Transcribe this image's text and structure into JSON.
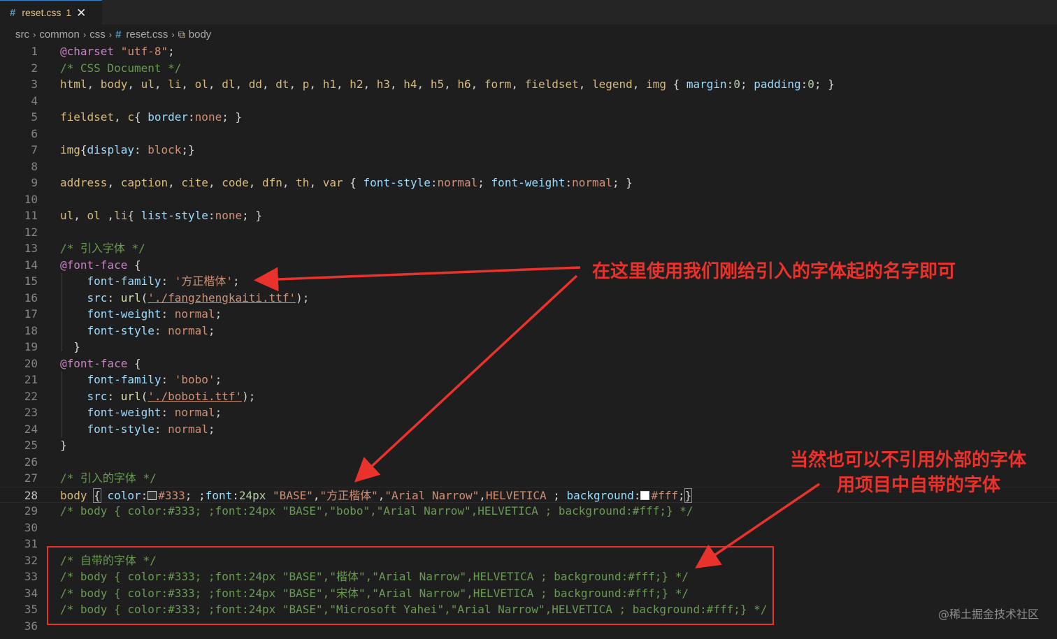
{
  "tab": {
    "icon": "css-hash-icon",
    "icon_glyph": "#",
    "filename": "reset.css",
    "problems": "1",
    "close_glyph": "✕"
  },
  "breadcrumb": {
    "items": [
      "src",
      "common",
      "css",
      "reset.css",
      "body"
    ],
    "separator": "›"
  },
  "editor": {
    "active_line": 28,
    "lines": [
      {
        "n": "1",
        "tokens": [
          [
            "at",
            "@charset"
          ],
          [
            "pun",
            " "
          ],
          [
            "str",
            "\"utf-8\""
          ],
          [
            "pun",
            ";"
          ]
        ]
      },
      {
        "n": "2",
        "tokens": [
          [
            "com",
            "/* CSS Document */"
          ]
        ]
      },
      {
        "n": "3",
        "tokens": [
          [
            "sel",
            "html"
          ],
          [
            "pun",
            ", "
          ],
          [
            "sel",
            "body"
          ],
          [
            "pun",
            ", "
          ],
          [
            "sel",
            "ul"
          ],
          [
            "pun",
            ", "
          ],
          [
            "sel",
            "li"
          ],
          [
            "pun",
            ", "
          ],
          [
            "sel",
            "ol"
          ],
          [
            "pun",
            ", "
          ],
          [
            "sel",
            "dl"
          ],
          [
            "pun",
            ", "
          ],
          [
            "sel",
            "dd"
          ],
          [
            "pun",
            ", "
          ],
          [
            "sel",
            "dt"
          ],
          [
            "pun",
            ", "
          ],
          [
            "sel",
            "p"
          ],
          [
            "pun",
            ", "
          ],
          [
            "sel",
            "h1"
          ],
          [
            "pun",
            ", "
          ],
          [
            "sel",
            "h2"
          ],
          [
            "pun",
            ", "
          ],
          [
            "sel",
            "h3"
          ],
          [
            "pun",
            ", "
          ],
          [
            "sel",
            "h4"
          ],
          [
            "pun",
            ", "
          ],
          [
            "sel",
            "h5"
          ],
          [
            "pun",
            ", "
          ],
          [
            "sel",
            "h6"
          ],
          [
            "pun",
            ", "
          ],
          [
            "sel",
            "form"
          ],
          [
            "pun",
            ", "
          ],
          [
            "sel",
            "fieldset"
          ],
          [
            "pun",
            ", "
          ],
          [
            "sel",
            "legend"
          ],
          [
            "pun",
            ", "
          ],
          [
            "sel",
            "img"
          ],
          [
            "pun",
            " { "
          ],
          [
            "prop",
            "margin"
          ],
          [
            "pun",
            ":"
          ],
          [
            "num",
            "0"
          ],
          [
            "pun",
            "; "
          ],
          [
            "prop",
            "padding"
          ],
          [
            "pun",
            ":"
          ],
          [
            "num",
            "0"
          ],
          [
            "pun",
            "; }"
          ]
        ]
      },
      {
        "n": "4",
        "tokens": []
      },
      {
        "n": "5",
        "tokens": [
          [
            "sel",
            "fieldset"
          ],
          [
            "pun",
            ", "
          ],
          [
            "sel",
            "c"
          ],
          [
            "pun",
            "{ "
          ],
          [
            "prop",
            "border"
          ],
          [
            "pun",
            ":"
          ],
          [
            "val",
            "none"
          ],
          [
            "pun",
            "; }"
          ]
        ]
      },
      {
        "n": "6",
        "tokens": []
      },
      {
        "n": "7",
        "tokens": [
          [
            "sel",
            "img"
          ],
          [
            "pun",
            "{"
          ],
          [
            "prop",
            "display"
          ],
          [
            "pun",
            ": "
          ],
          [
            "val",
            "block"
          ],
          [
            "pun",
            ";}"
          ]
        ]
      },
      {
        "n": "8",
        "tokens": []
      },
      {
        "n": "9",
        "tokens": [
          [
            "sel",
            "address"
          ],
          [
            "pun",
            ", "
          ],
          [
            "sel",
            "caption"
          ],
          [
            "pun",
            ", "
          ],
          [
            "sel",
            "cite"
          ],
          [
            "pun",
            ", "
          ],
          [
            "sel",
            "code"
          ],
          [
            "pun",
            ", "
          ],
          [
            "sel",
            "dfn"
          ],
          [
            "pun",
            ", "
          ],
          [
            "sel",
            "th"
          ],
          [
            "pun",
            ", "
          ],
          [
            "sel",
            "var"
          ],
          [
            "pun",
            " { "
          ],
          [
            "prop",
            "font-style"
          ],
          [
            "pun",
            ":"
          ],
          [
            "val",
            "normal"
          ],
          [
            "pun",
            "; "
          ],
          [
            "prop",
            "font-weight"
          ],
          [
            "pun",
            ":"
          ],
          [
            "val",
            "normal"
          ],
          [
            "pun",
            "; }"
          ]
        ]
      },
      {
        "n": "10",
        "tokens": []
      },
      {
        "n": "11",
        "tokens": [
          [
            "sel",
            "ul"
          ],
          [
            "pun",
            ", "
          ],
          [
            "sel",
            "ol"
          ],
          [
            "pun",
            " ,"
          ],
          [
            "sel",
            "li"
          ],
          [
            "pun",
            "{ "
          ],
          [
            "prop",
            "list-style"
          ],
          [
            "pun",
            ":"
          ],
          [
            "val",
            "none"
          ],
          [
            "pun",
            "; }"
          ]
        ]
      },
      {
        "n": "12",
        "tokens": []
      },
      {
        "n": "13",
        "tokens": [
          [
            "com",
            "/* 引入字体 */"
          ]
        ]
      },
      {
        "n": "14",
        "tokens": [
          [
            "at",
            "@font-face"
          ],
          [
            "pun",
            " {"
          ]
        ]
      },
      {
        "n": "15",
        "tokens": [
          [
            "pun",
            "    "
          ],
          [
            "prop",
            "font-family"
          ],
          [
            "pun",
            ": "
          ],
          [
            "str",
            "'方正楷体'"
          ],
          [
            "pun",
            ";"
          ]
        ]
      },
      {
        "n": "16",
        "tokens": [
          [
            "pun",
            "    "
          ],
          [
            "prop",
            "src"
          ],
          [
            "pun",
            ": "
          ],
          [
            "fn",
            "url"
          ],
          [
            "pun",
            "("
          ],
          [
            "url",
            "'./fangzhengkaiti.ttf'"
          ],
          [
            "pun",
            ");"
          ]
        ]
      },
      {
        "n": "17",
        "tokens": [
          [
            "pun",
            "    "
          ],
          [
            "prop",
            "font-weight"
          ],
          [
            "pun",
            ": "
          ],
          [
            "val",
            "normal"
          ],
          [
            "pun",
            ";"
          ]
        ]
      },
      {
        "n": "18",
        "tokens": [
          [
            "pun",
            "    "
          ],
          [
            "prop",
            "font-style"
          ],
          [
            "pun",
            ": "
          ],
          [
            "val",
            "normal"
          ],
          [
            "pun",
            ";"
          ]
        ]
      },
      {
        "n": "19",
        "tokens": [
          [
            "pun",
            "  }"
          ]
        ]
      },
      {
        "n": "20",
        "tokens": [
          [
            "at",
            "@font-face"
          ],
          [
            "pun",
            " {"
          ]
        ]
      },
      {
        "n": "21",
        "tokens": [
          [
            "pun",
            "    "
          ],
          [
            "prop",
            "font-family"
          ],
          [
            "pun",
            ": "
          ],
          [
            "str",
            "'bobo'"
          ],
          [
            "pun",
            ";"
          ]
        ]
      },
      {
        "n": "22",
        "tokens": [
          [
            "pun",
            "    "
          ],
          [
            "prop",
            "src"
          ],
          [
            "pun",
            ": "
          ],
          [
            "fn",
            "url"
          ],
          [
            "pun",
            "("
          ],
          [
            "url",
            "'./boboti.ttf'"
          ],
          [
            "pun",
            ");"
          ]
        ]
      },
      {
        "n": "23",
        "tokens": [
          [
            "pun",
            "    "
          ],
          [
            "prop",
            "font-weight"
          ],
          [
            "pun",
            ": "
          ],
          [
            "val",
            "normal"
          ],
          [
            "pun",
            ";"
          ]
        ]
      },
      {
        "n": "24",
        "tokens": [
          [
            "pun",
            "    "
          ],
          [
            "prop",
            "font-style"
          ],
          [
            "pun",
            ": "
          ],
          [
            "val",
            "normal"
          ],
          [
            "pun",
            ";"
          ]
        ]
      },
      {
        "n": "25",
        "tokens": [
          [
            "pun",
            "}"
          ]
        ]
      },
      {
        "n": "26",
        "tokens": []
      },
      {
        "n": "27",
        "tokens": [
          [
            "com",
            "/* 引入的字体 */"
          ]
        ]
      },
      {
        "n": "28",
        "tokens": [
          [
            "sel",
            "body"
          ],
          [
            "pun",
            " "
          ],
          [
            "brk",
            "{"
          ],
          [
            "pun",
            " "
          ],
          [
            "prop",
            "color"
          ],
          [
            "pun",
            ":"
          ],
          [
            "sw",
            "#333333"
          ],
          [
            "val",
            "#333"
          ],
          [
            "pun",
            "; ;"
          ],
          [
            "prop",
            "font"
          ],
          [
            "pun",
            ":"
          ],
          [
            "num",
            "24px"
          ],
          [
            "pun",
            " "
          ],
          [
            "str",
            "\"BASE\""
          ],
          [
            "pun",
            ","
          ],
          [
            "str",
            "\"方正楷体\""
          ],
          [
            "pun",
            ","
          ],
          [
            "str",
            "\"Arial Narrow\""
          ],
          [
            "pun",
            ","
          ],
          [
            "val",
            "HELVETICA"
          ],
          [
            "pun",
            " ; "
          ],
          [
            "prop",
            "background"
          ],
          [
            "pun",
            ":"
          ],
          [
            "sw",
            "#ffffff"
          ],
          [
            "val",
            "#fff"
          ],
          [
            "pun",
            ";"
          ],
          [
            "brk",
            "}"
          ]
        ]
      },
      {
        "n": "29",
        "tokens": [
          [
            "com",
            "/* body { color:#333; ;font:24px \"BASE\",\"bobo\",\"Arial Narrow\",HELVETICA ; background:#fff;} */"
          ]
        ]
      },
      {
        "n": "30",
        "tokens": []
      },
      {
        "n": "31",
        "tokens": []
      },
      {
        "n": "32",
        "tokens": [
          [
            "com",
            "/* 自带的字体 */"
          ]
        ]
      },
      {
        "n": "33",
        "tokens": [
          [
            "com",
            "/* body { color:#333; ;font:24px \"BASE\",\"楷体\",\"Arial Narrow\",HELVETICA ; background:#fff;} */"
          ]
        ]
      },
      {
        "n": "34",
        "tokens": [
          [
            "com",
            "/* body { color:#333; ;font:24px \"BASE\",\"宋体\",\"Arial Narrow\",HELVETICA ; background:#fff;} */"
          ]
        ]
      },
      {
        "n": "35",
        "tokens": [
          [
            "com",
            "/* body { color:#333; ;font:24px \"BASE\",\"Microsoft Yahei\",\"Arial Narrow\",HELVETICA ; background:#fff;} */"
          ]
        ]
      },
      {
        "n": "36",
        "tokens": []
      }
    ]
  },
  "annotations": {
    "note1": "在这里使用我们刚给引入的字体起的名字即可",
    "note2_line1": "当然也可以不引用外部的字体",
    "note2_line2": "用项目中自带的字体",
    "color": "#e8322b"
  },
  "watermark": "@稀土掘金技术社区"
}
